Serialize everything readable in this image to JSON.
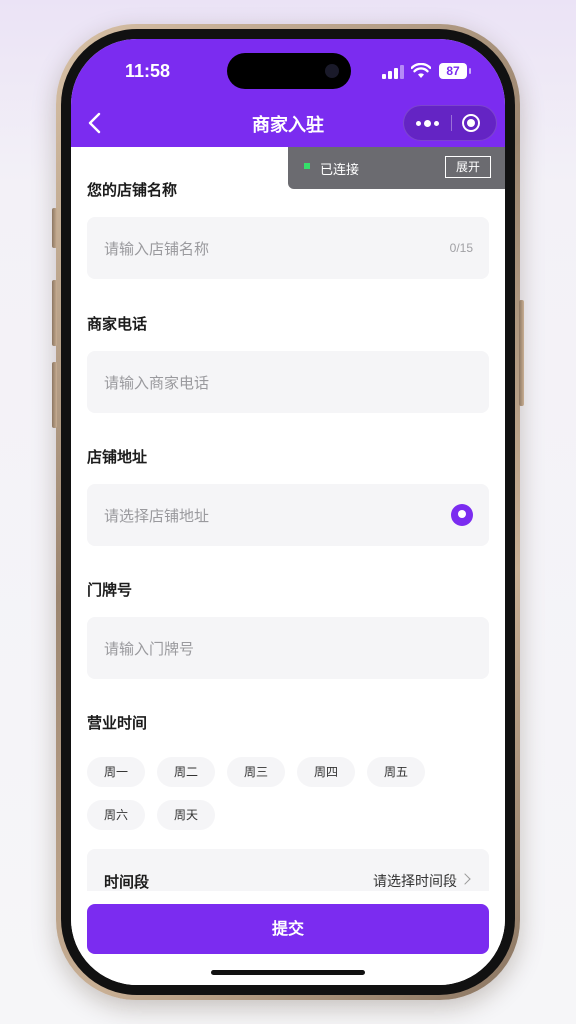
{
  "status_bar": {
    "time": "11:58",
    "battery": "87"
  },
  "nav": {
    "title": "商家入驻"
  },
  "connection_tip": {
    "status": "已连接",
    "expand_label": "展开"
  },
  "form": {
    "shop_name": {
      "label": "您的店铺名称",
      "placeholder": "请输入店铺名称",
      "counter": "0/15"
    },
    "phone": {
      "label": "商家电话",
      "placeholder": "请输入商家电话"
    },
    "address": {
      "label": "店铺地址",
      "placeholder": "请选择店铺地址"
    },
    "door_number": {
      "label": "门牌号",
      "placeholder": "请输入门牌号"
    },
    "business_hours": {
      "label": "营业时间",
      "days": [
        "周一",
        "周二",
        "周三",
        "周四",
        "周五",
        "周六",
        "周天"
      ]
    },
    "time_period": {
      "label": "时间段",
      "value": "请选择时间段"
    }
  },
  "footer": {
    "submit_label": "提交"
  },
  "colors": {
    "accent": "#7b2cf0",
    "field_bg": "#f5f5f7",
    "connected": "#35e06a"
  }
}
